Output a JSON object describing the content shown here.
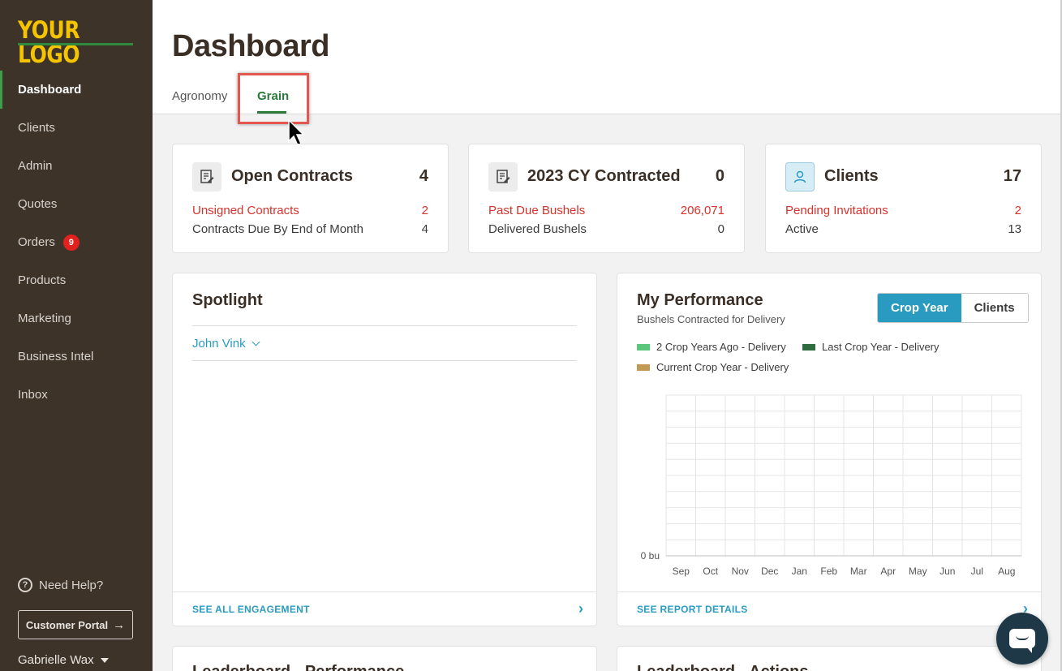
{
  "sidebar": {
    "logo": "YOUR LOGO",
    "items": [
      {
        "label": "Dashboard",
        "active": true
      },
      {
        "label": "Clients"
      },
      {
        "label": "Admin"
      },
      {
        "label": "Quotes"
      },
      {
        "label": "Orders",
        "badge": "9"
      },
      {
        "label": "Products"
      },
      {
        "label": "Marketing"
      },
      {
        "label": "Business Intel"
      },
      {
        "label": "Inbox"
      }
    ],
    "help": "Need Help?",
    "portal_button": "Customer Portal",
    "user": "Gabrielle Wax"
  },
  "header": {
    "title": "Dashboard",
    "tabs": [
      {
        "label": "Agronomy",
        "active": false
      },
      {
        "label": "Grain",
        "active": true
      }
    ]
  },
  "stats": [
    {
      "title": "Open Contracts",
      "count": "4",
      "icon": "contract-icon",
      "rows": [
        {
          "label": "Unsigned Contracts",
          "value": "2",
          "alert": true
        },
        {
          "label": "Contracts Due By End of Month",
          "value": "4"
        }
      ]
    },
    {
      "title": "2023 CY Contracted",
      "count": "0",
      "icon": "contract-icon",
      "rows": [
        {
          "label": "Past Due Bushels",
          "value": "206,071",
          "alert": true
        },
        {
          "label": "Delivered Bushels",
          "value": "0"
        }
      ]
    },
    {
      "title": "Clients",
      "count": "17",
      "icon": "person-icon",
      "rows": [
        {
          "label": "Pending Invitations",
          "value": "2",
          "alert": true
        },
        {
          "label": "Active",
          "value": "13"
        }
      ]
    }
  ],
  "spotlight": {
    "title": "Spotlight",
    "selected": "John Vink",
    "footer_link": "SEE ALL ENGAGEMENT"
  },
  "performance": {
    "title": "My Performance",
    "subtitle": "Bushels Contracted for Delivery",
    "toggle": [
      {
        "label": "Crop Year",
        "active": true
      },
      {
        "label": "Clients",
        "active": false
      }
    ],
    "footer_link": "SEE REPORT DETAILS"
  },
  "chart_data": {
    "type": "bar",
    "categories": [
      "Sep",
      "Oct",
      "Nov",
      "Dec",
      "Jan",
      "Feb",
      "Mar",
      "Apr",
      "May",
      "Jun",
      "Jul",
      "Aug"
    ],
    "series": [
      {
        "name": "2 Crop Years Ago - Delivery",
        "color": "#5ac87a",
        "values": [
          0,
          0,
          0,
          0,
          0,
          0,
          0,
          0,
          0,
          0,
          0,
          0
        ]
      },
      {
        "name": "Last Crop Year - Delivery",
        "color": "#2e6e3e",
        "values": [
          0,
          0,
          0,
          0,
          0,
          0,
          0,
          0,
          0,
          0,
          0,
          0
        ]
      },
      {
        "name": "Current Crop Year - Delivery",
        "color": "#c19a55",
        "values": [
          0,
          0,
          0,
          0,
          0,
          0,
          0,
          0,
          0,
          0,
          0,
          0
        ]
      }
    ],
    "y_tick_labels": [
      "0 bu"
    ],
    "grid": true,
    "legend_position": "top"
  },
  "bottom_cards": [
    {
      "title": "Leaderboard - Performance"
    },
    {
      "title": "Leaderboard - Actions"
    }
  ],
  "colors": {
    "sidebar": "#3e3329",
    "accent_green": "#2a7a3c",
    "accent_blue": "#2a9bc0",
    "alert_red": "#d9312b",
    "logo_yellow": "#f5c400"
  }
}
